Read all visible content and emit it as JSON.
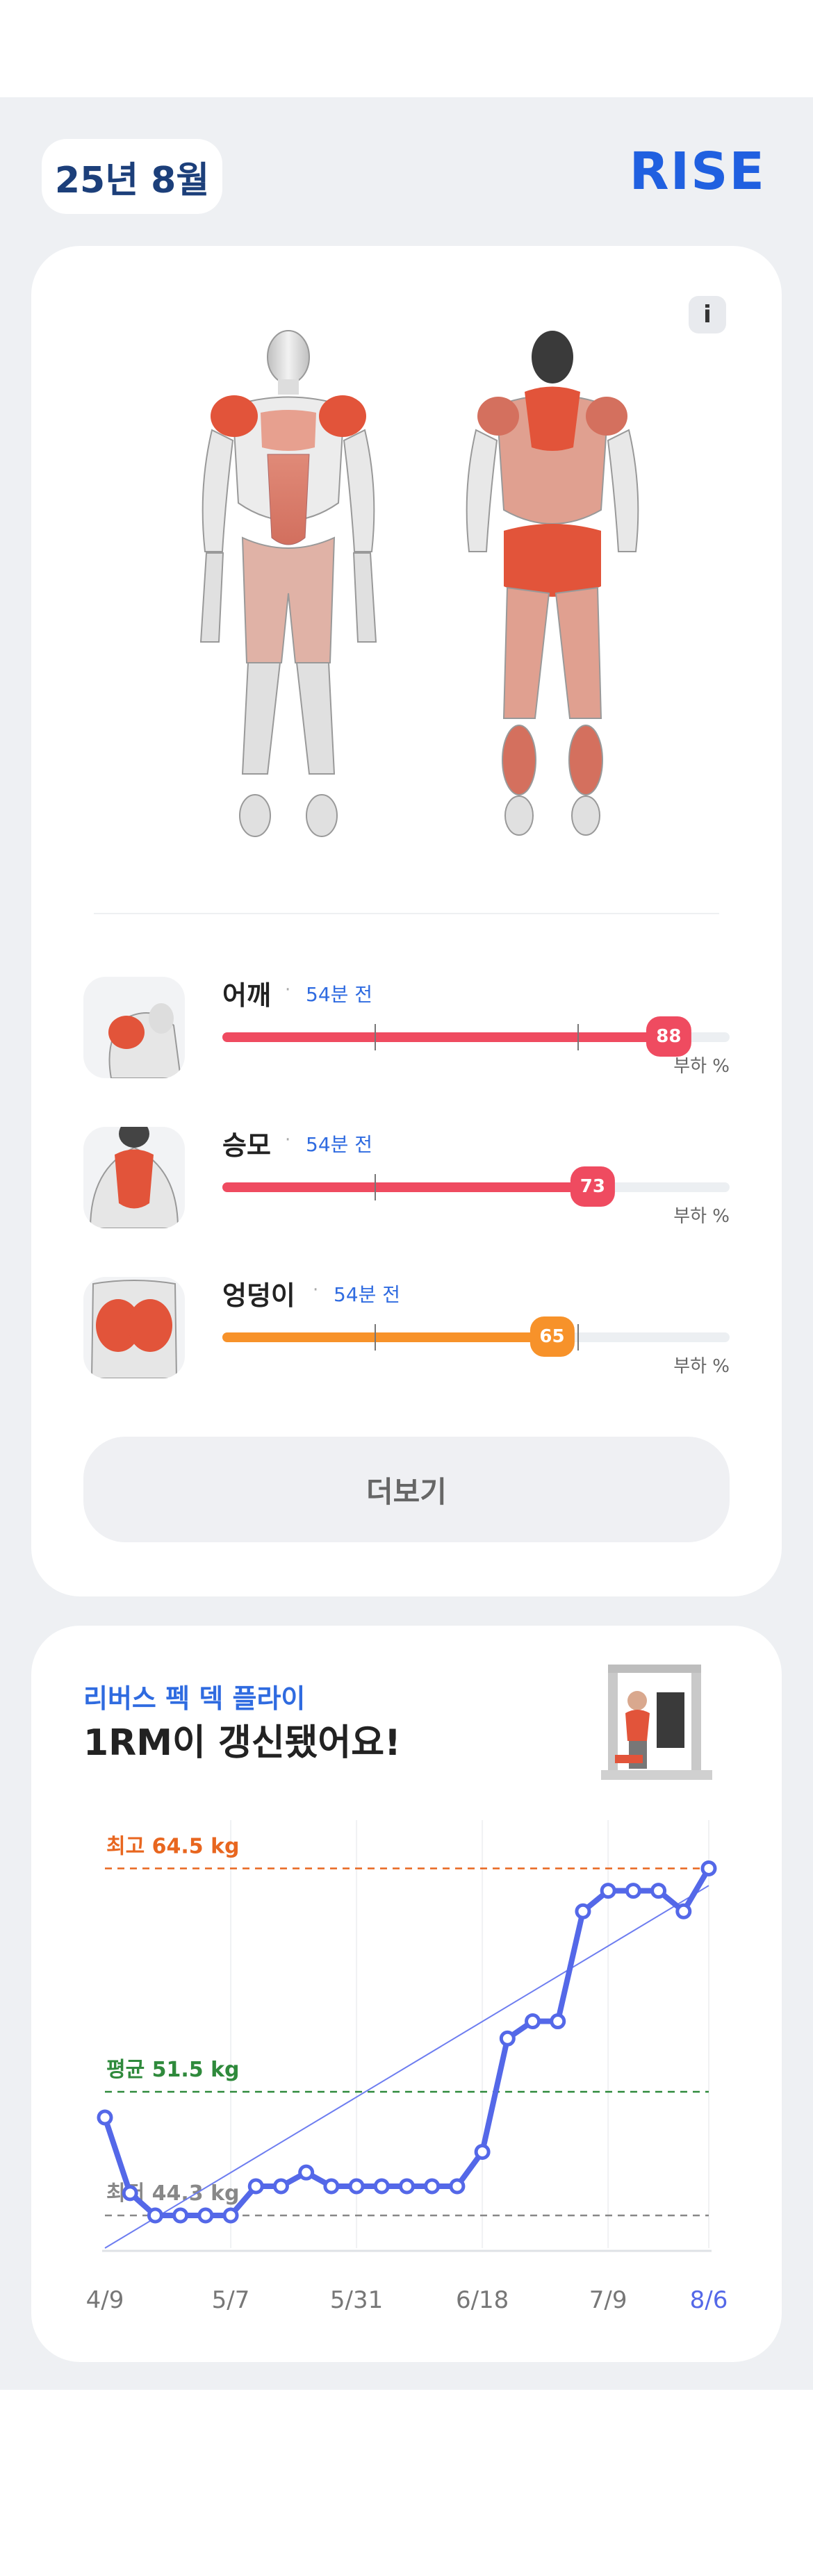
{
  "header": {
    "month": "25년 8월",
    "brand": "RISE"
  },
  "body_map": {
    "info_label": "i",
    "highlight_color": "#e2543a"
  },
  "muscles": [
    {
      "name": "어깨",
      "time": "54분 전",
      "load": 88,
      "color": "#ef4b60",
      "load_label": "부하 %"
    },
    {
      "name": "승모",
      "time": "54분 전",
      "load": 73,
      "color": "#ef4b60",
      "load_label": "부하 %"
    },
    {
      "name": "엉덩이",
      "time": "54분 전",
      "load": 65,
      "color": "#f7922a",
      "load_label": "부하 %"
    }
  ],
  "more_label": "더보기",
  "exercise": {
    "name": "리버스 펙 덱 플라이",
    "headline": "1RM이 갱신됐어요!"
  },
  "chart_data": {
    "type": "line",
    "x_tick_labels": [
      "4/9",
      "5/7",
      "5/31",
      "6/18",
      "7/9",
      "8/6"
    ],
    "x_tick_index": [
      0,
      5,
      10,
      15,
      20,
      24
    ],
    "values": [
      50.0,
      45.6,
      44.3,
      44.3,
      44.3,
      44.3,
      46.0,
      46.0,
      46.8,
      46.0,
      46.0,
      46.0,
      46.0,
      46.0,
      46.0,
      48.0,
      54.6,
      55.6,
      55.6,
      62.0,
      63.2,
      63.2,
      63.2,
      62.0,
      64.5
    ],
    "ylim": [
      42.4,
      66.5
    ],
    "reference_lines": [
      {
        "label": "최고 64.5 kg",
        "value": 64.5,
        "color": "#e8661f"
      },
      {
        "label": "평균 51.5 kg",
        "value": 51.5,
        "color": "#2f8a3c"
      },
      {
        "label": "최저 44.3 kg",
        "value": 44.3,
        "color": "#888888"
      }
    ],
    "trend": [
      42.4,
      63.5
    ],
    "line_color": "#5468e8",
    "last_tick_color": "#5468e8"
  }
}
